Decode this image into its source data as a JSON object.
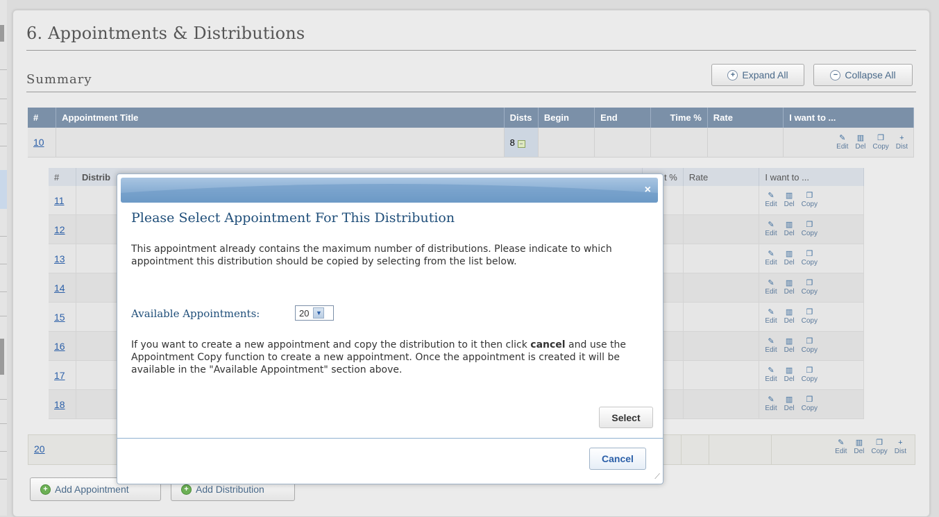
{
  "section_title": "6. Appointments & Distributions",
  "summary_title": "Summary",
  "expand_all": "Expand All",
  "collapse_all": "Collapse All",
  "main_table": {
    "headers": [
      "#",
      "Appointment Title",
      "Dists",
      "Begin",
      "End",
      "Time %",
      "Rate",
      "I want to ..."
    ],
    "row": {
      "id": "10",
      "dists": "8"
    }
  },
  "sub_table": {
    "headers": [
      "#",
      "Distrib",
      "t %",
      "Rate",
      "I want to ..."
    ],
    "rows": [
      "11",
      "12",
      "13",
      "14",
      "15",
      "16",
      "17",
      "18"
    ]
  },
  "row20": {
    "id": "20"
  },
  "actions": {
    "edit": "Edit",
    "del": "Del",
    "copy": "Copy",
    "dist": "Dist"
  },
  "buttons": {
    "add_appointment": "Add Appointment",
    "add_distribution": "Add Distribution"
  },
  "dialog": {
    "close": "×",
    "title": "Please Select Appointment For This Distribution",
    "para1": "This appointment already contains the maximum number of distributions. Please indicate to which appointment this distribution should be copied by selecting from the list below.",
    "available_label": "Available Appointments:",
    "selected_value": "20",
    "para2_before": "If you want to create a new appointment and copy the distribution to it then click",
    "para2_bold": "cancel",
    "para2_after": "and use the Appointment Copy function to create a new appointment. Once the appointment is created it will be available in the \"Available Appointment\" section above.",
    "select_btn": "Select",
    "cancel_btn": "Cancel"
  }
}
